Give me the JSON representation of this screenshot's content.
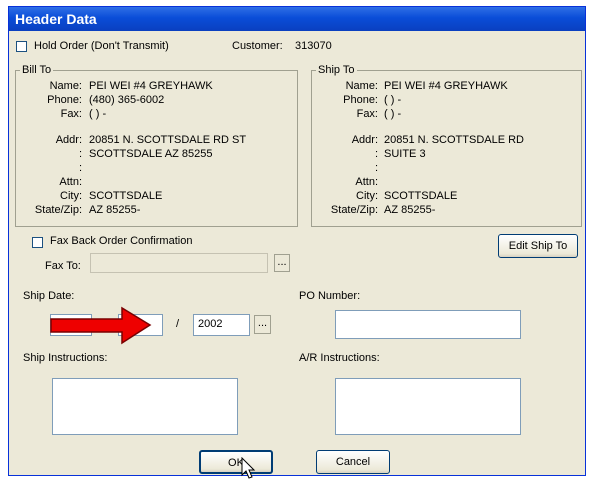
{
  "window": {
    "title": "Header Data"
  },
  "hold_order": {
    "label": "Hold Order (Don't Transmit)",
    "checked": false
  },
  "customer": {
    "label": "Customer:",
    "value": "313070"
  },
  "bill_to": {
    "legend": "Bill To",
    "name_label": "Name:",
    "name": "PEI WEI #4 GREYHAWK",
    "phone_label": "Phone:",
    "phone": "(480) 365-6002",
    "fax_label": "Fax:",
    "fax": "(  )  -",
    "addr_label": "Addr:",
    "addr1": "20851 N. SCOTTSDALE RD ST",
    "addr2": "SCOTTSDALE AZ 85255",
    "colon1": ":",
    "colon2": ":",
    "attn_label": "Attn:",
    "attn": "",
    "city_label": "City:",
    "city": "SCOTTSDALE",
    "statezip_label": "State/Zip:",
    "statezip": "AZ 85255-"
  },
  "ship_to": {
    "legend": "Ship To",
    "name_label": "Name:",
    "name": "PEI WEI #4 GREYHAWK",
    "phone_label": "Phone:",
    "phone": "(  )  -",
    "fax_label": "Fax:",
    "fax": "(  )  -",
    "addr_label": "Addr:",
    "addr1": "20851 N. SCOTTSDALE RD",
    "addr2": "SUITE 3",
    "colon1": ":",
    "colon2": ":",
    "attn_label": "Attn:",
    "attn": "",
    "city_label": "City:",
    "city": "SCOTTSDALE",
    "statezip_label": "State/Zip:",
    "statezip": "AZ 85255-"
  },
  "fax_back": {
    "label": "Fax Back Order Confirmation",
    "checked": false
  },
  "fax_to": {
    "label": "Fax To:",
    "value": "",
    "browse_label": "..."
  },
  "edit_ship_to": {
    "label": "Edit Ship To"
  },
  "ship_date": {
    "label": "Ship Date:",
    "month": "",
    "day": "",
    "separator": "/",
    "year": "2002",
    "picker_label": "..."
  },
  "po_number": {
    "label": "PO Number:",
    "value": ""
  },
  "ship_instructions": {
    "label": "Ship Instructions:",
    "value": ""
  },
  "ar_instructions": {
    "label": "A/R Instructions:",
    "value": ""
  },
  "buttons": {
    "ok": "OK",
    "cancel": "Cancel"
  },
  "colors": {
    "title_bar": "#0a4dd8",
    "dialog_bg": "#ece9d8",
    "arrow": "#ee0000"
  },
  "icons": {
    "annotation_arrow": "red-arrow-icon",
    "cursor": "mouse-pointer-icon"
  }
}
